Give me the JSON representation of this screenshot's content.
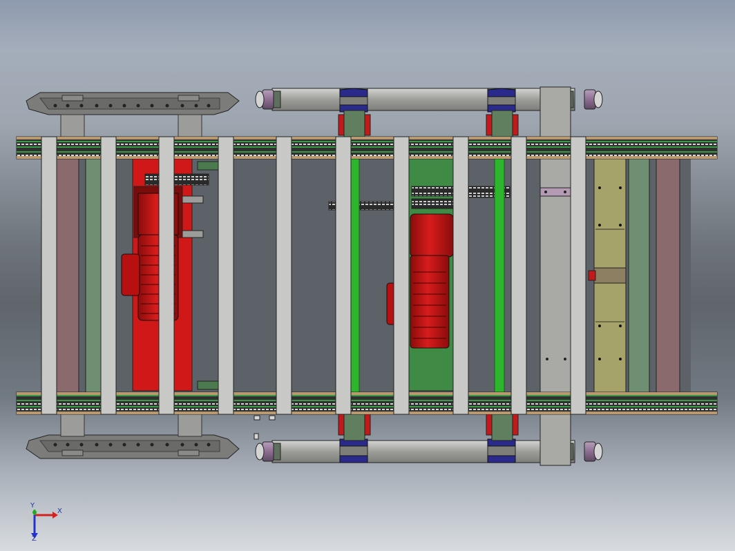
{
  "view": {
    "background_top": "#8e9aae",
    "background_bottom": "#d8dce0"
  },
  "colors": {
    "frame_grey": "#a9a9a6",
    "crossbar": "#c8c8c6",
    "motor_red": "#d01818",
    "green_plate": "#3f8a44",
    "green_shaft": "#2db52d",
    "olive_guide": "#a6a36a",
    "mauve_pad": "#8a6a6c",
    "bracket_blue": "#2a2a8c",
    "wheel_mauve": "#8e6e92",
    "chain_green": "#3a9a48"
  },
  "triad": {
    "x_label": "X",
    "y_label": "Y",
    "z_label": "Z",
    "x_icon": "x-axis-arrow-icon",
    "y_icon": "y-axis-arrow-icon",
    "z_icon": "z-axis-arrow-icon"
  }
}
